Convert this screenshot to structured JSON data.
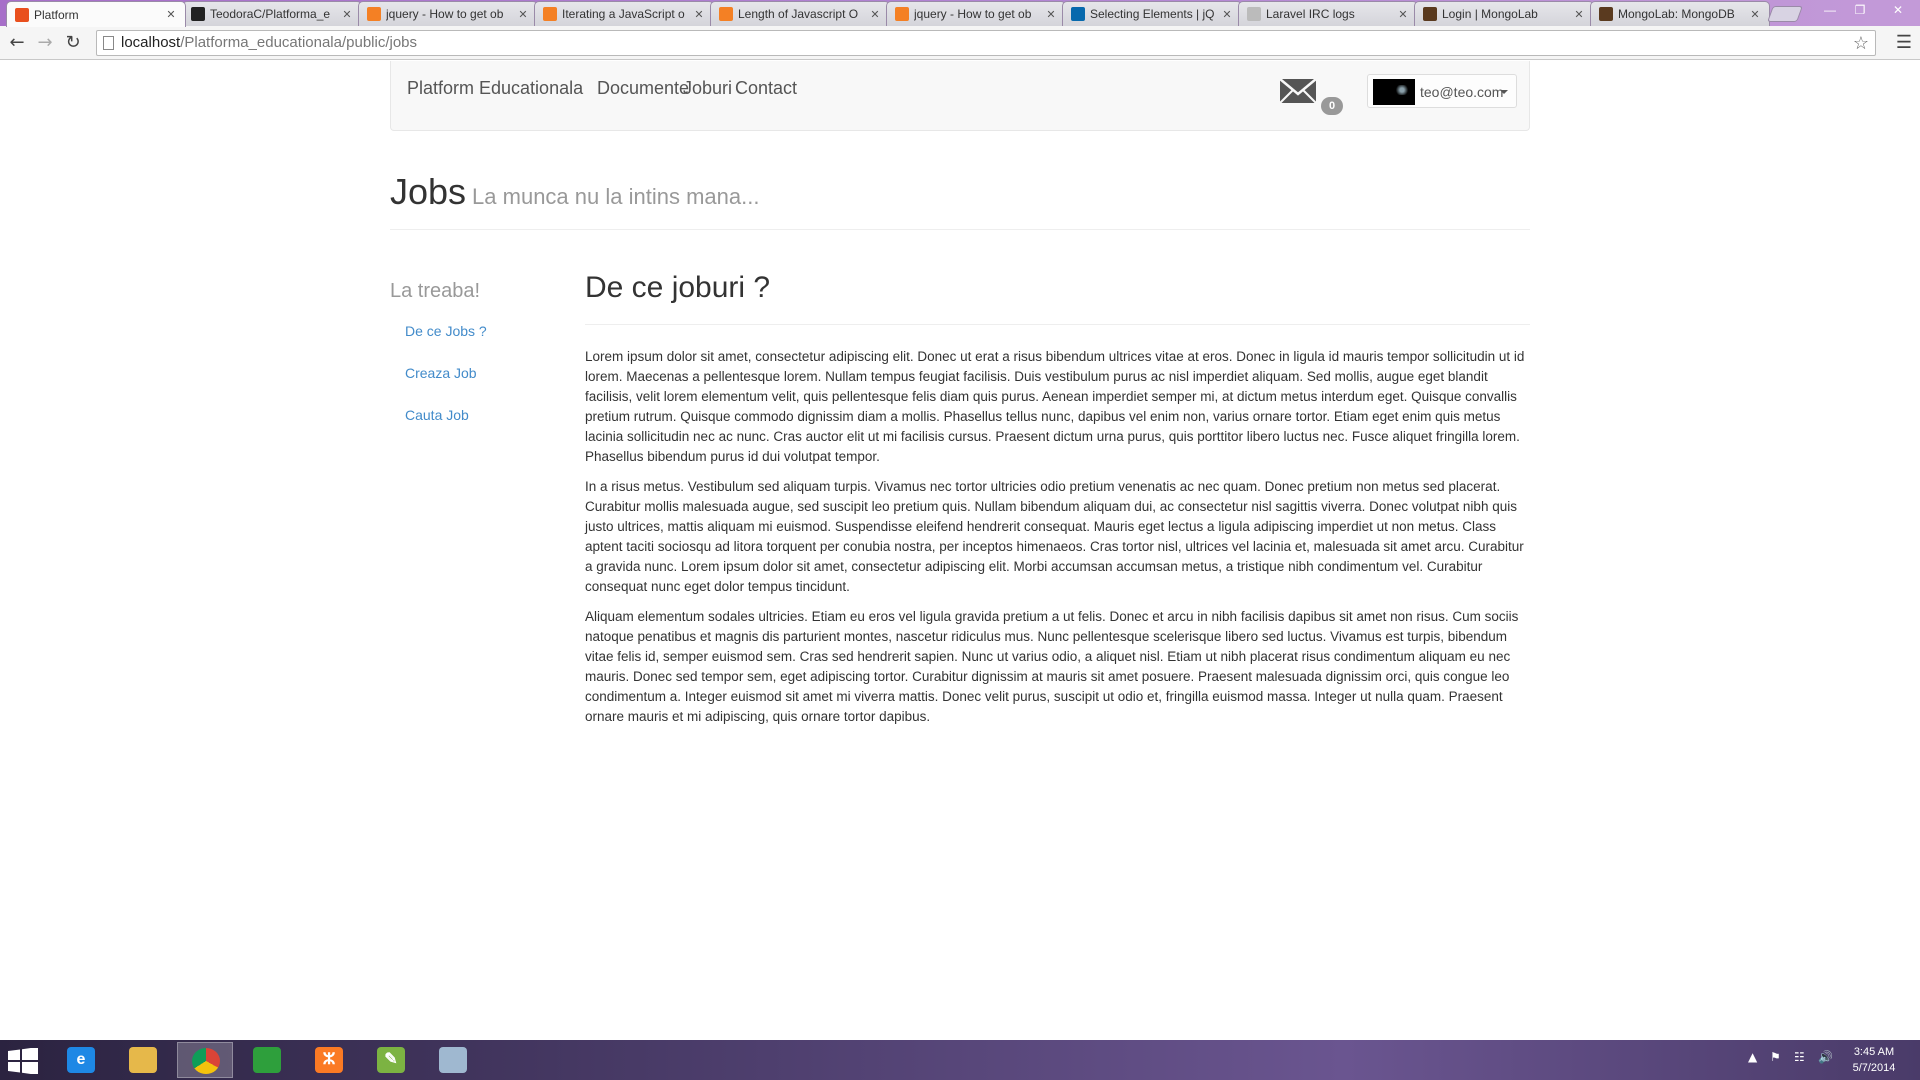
{
  "browser": {
    "tabs": [
      {
        "title": "Platform",
        "icon": "platform-favicon",
        "color": "#e9501e",
        "active": true
      },
      {
        "title": "TeodoraC/Platforma_e",
        "icon": "github-favicon",
        "color": "#222222"
      },
      {
        "title": "jquery - How to get ob",
        "icon": "stackoverflow-favicon",
        "color": "#f48024"
      },
      {
        "title": "Iterating a JavaScript o",
        "icon": "stackoverflow-favicon",
        "color": "#f48024"
      },
      {
        "title": "Length of Javascript O",
        "icon": "stackoverflow-favicon",
        "color": "#f48024"
      },
      {
        "title": "jquery - How to get ob",
        "icon": "stackoverflow-favicon",
        "color": "#f48024"
      },
      {
        "title": "Selecting Elements | jQ",
        "icon": "jquery-favicon",
        "color": "#0769ad"
      },
      {
        "title": "Laravel IRC logs",
        "icon": "document-favicon",
        "color": "#bbbbbb"
      },
      {
        "title": "Login | MongoLab",
        "icon": "mongolab-favicon",
        "color": "#5a3a1f"
      },
      {
        "title": "MongoLab: MongoDB",
        "icon": "mongolab-favicon",
        "color": "#5a3a1f"
      }
    ],
    "address": {
      "host": "localhost",
      "path": "/Platforma_educationala/public/jobs"
    }
  },
  "navbar": {
    "brand": "Platform Educationala",
    "links": [
      "Documente",
      "Joburi",
      "Contact"
    ],
    "mail_count": "0",
    "user_email": "teo@teo.com"
  },
  "page": {
    "title": "Jobs",
    "subtitle": "La munca nu la intins mana..."
  },
  "sidebar": {
    "title": "La treaba!",
    "items": [
      "De ce Jobs ?",
      "Creaza Job",
      "Cauta Job"
    ]
  },
  "content": {
    "heading": "De ce joburi ?",
    "paragraphs": [
      "Lorem ipsum dolor sit amet, consectetur adipiscing elit. Donec ut erat a risus bibendum ultrices vitae at eros. Donec in ligula id mauris tempor sollicitudin ut id lorem. Maecenas a pellentesque lorem. Nullam tempus feugiat facilisis. Duis vestibulum purus ac nisl imperdiet aliquam. Sed mollis, augue eget blandit facilisis, velit lorem elementum velit, quis pellentesque felis diam quis purus. Aenean imperdiet semper mi, at dictum metus interdum eget. Quisque convallis pretium rutrum. Quisque commodo dignissim diam a mollis. Phasellus tellus nunc, dapibus vel enim non, varius ornare tortor. Etiam eget enim quis metus lacinia sollicitudin nec ac nunc. Cras auctor elit ut mi facilisis cursus. Praesent dictum urna purus, quis porttitor libero luctus nec. Fusce aliquet fringilla lorem. Phasellus bibendum purus id dui volutpat tempor.",
      "In a risus metus. Vestibulum sed aliquam turpis. Vivamus nec tortor ultricies odio pretium venenatis ac nec quam. Donec pretium non metus sed placerat. Curabitur mollis malesuada augue, sed suscipit leo pretium quis. Nullam bibendum aliquam dui, ac consectetur nisl sagittis viverra. Donec volutpat nibh quis justo ultrices, mattis aliquam mi euismod. Suspendisse eleifend hendrerit consequat. Mauris eget lectus a ligula adipiscing imperdiet ut non metus. Class aptent taciti sociosqu ad litora torquent per conubia nostra, per inceptos himenaeos. Cras tortor nisl, ultrices vel lacinia et, malesuada sit amet arcu. Curabitur a gravida nunc. Lorem ipsum dolor sit amet, consectetur adipiscing elit. Morbi accumsan accumsan metus, a tristique nibh condimentum vel. Curabitur consequat nunc eget dolor tempus tincidunt.",
      "Aliquam elementum sodales ultricies. Etiam eu eros vel ligula gravida pretium a ut felis. Donec et arcu in nibh facilisis dapibus sit amet non risus. Cum sociis natoque penatibus et magnis dis parturient montes, nascetur ridiculus mus. Nunc pellentesque scelerisque libero sed luctus. Vivamus est turpis, bibendum vitae felis id, semper euismod sem. Cras sed hendrerit sapien. Nunc ut varius odio, a aliquet nisl. Etiam ut nibh placerat risus condimentum aliquam eu nec mauris. Donec sed tempor sem, eget adipiscing tortor. Curabitur dignissim at mauris sit amet posuere. Praesent malesuada dignissim orci, quis congue leo condimentum a. Integer euismod sit amet mi viverra mattis. Donec velit purus, suscipit ut odio et, fringilla euismod massa. Integer ut nulla quam. Praesent ornare mauris et mi adipiscing, quis ornare tortor dapibus."
    ]
  },
  "taskbar": {
    "apps": [
      {
        "name": "internet-explorer",
        "glyph": "e",
        "color": "#1e88e5"
      },
      {
        "name": "file-explorer",
        "glyph": "",
        "color": "#e6b84a"
      },
      {
        "name": "chrome",
        "glyph": "",
        "color": "#db4437",
        "active": true
      },
      {
        "name": "store",
        "glyph": "",
        "color": "#2e9f3c"
      },
      {
        "name": "xampp",
        "glyph": "ⵣ",
        "color": "#fb7a24"
      },
      {
        "name": "notepad-plus-plus",
        "glyph": "✎",
        "color": "#7cb342"
      },
      {
        "name": "paint",
        "glyph": "",
        "color": "#9fb8d0"
      }
    ],
    "clock": {
      "time": "3:45 AM",
      "date": "5/7/2014"
    }
  }
}
